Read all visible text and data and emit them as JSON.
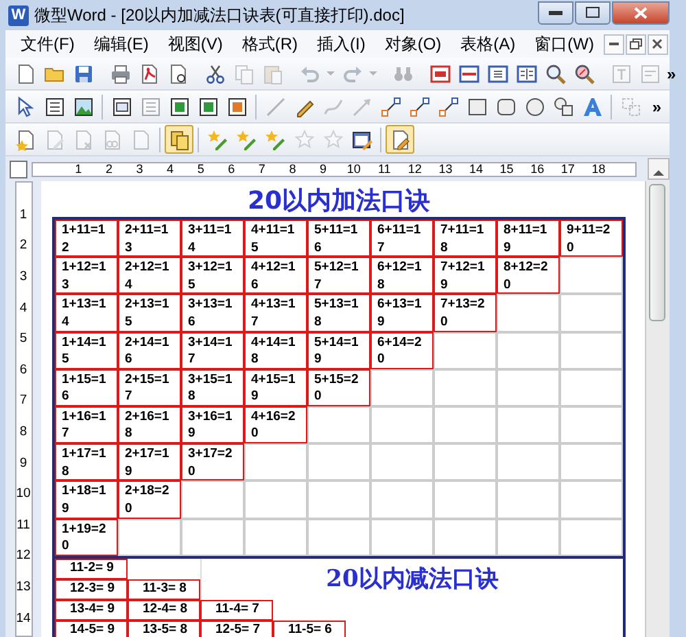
{
  "window": {
    "icon_letter": "W",
    "title": "微型Word - [20以内加减法口诀表(可直接打印).doc]"
  },
  "menu": [
    {
      "label": "文件(F)"
    },
    {
      "label": "编辑(E)"
    },
    {
      "label": "视图(V)"
    },
    {
      "label": "格式(R)"
    },
    {
      "label": "插入(I)"
    },
    {
      "label": "对象(O)"
    },
    {
      "label": "表格(A)"
    },
    {
      "label": "窗口(W)"
    }
  ],
  "toolbars": [
    {
      "overflow": "»",
      "groups": [
        [
          {
            "kind": "page",
            "disabled": false,
            "pressed": false
          },
          {
            "kind": "folder",
            "disabled": false,
            "pressed": false
          },
          {
            "kind": "disk",
            "disabled": false,
            "pressed": false
          }
        ],
        [
          {
            "kind": "printer",
            "disabled": false,
            "pressed": false
          },
          {
            "kind": "pdf",
            "disabled": false,
            "pressed": false
          },
          {
            "kind": "preview",
            "disabled": false,
            "pressed": false
          }
        ],
        [
          {
            "kind": "scissors",
            "disabled": false,
            "pressed": false
          },
          {
            "kind": "copy",
            "disabled": true,
            "pressed": false
          },
          {
            "kind": "paste",
            "disabled": true,
            "pressed": false
          }
        ],
        [
          {
            "kind": "undo",
            "disabled": true,
            "pressed": false
          },
          {
            "kind": "dropdown",
            "disabled": true,
            "pressed": false
          },
          {
            "kind": "redo",
            "disabled": true,
            "pressed": false
          },
          {
            "kind": "dropdown",
            "disabled": true,
            "pressed": false
          }
        ],
        [
          {
            "kind": "binoculars",
            "disabled": true,
            "pressed": false
          }
        ],
        [
          {
            "kind": "actual-size",
            "disabled": false,
            "pressed": false
          },
          {
            "kind": "fit-width",
            "disabled": false,
            "pressed": false
          },
          {
            "kind": "page-view",
            "disabled": false,
            "pressed": false
          },
          {
            "kind": "two-page",
            "disabled": false,
            "pressed": false
          },
          {
            "kind": "magnifier",
            "disabled": false,
            "pressed": false
          },
          {
            "kind": "zoom-percent",
            "disabled": false,
            "pressed": false
          }
        ],
        [
          {
            "kind": "text-box",
            "disabled": true,
            "pressed": false
          },
          {
            "kind": "field",
            "disabled": true,
            "pressed": false
          }
        ]
      ]
    },
    {
      "overflow": "»",
      "groups": [
        [
          {
            "kind": "cursor",
            "disabled": false,
            "pressed": false
          },
          {
            "kind": "frame",
            "disabled": false,
            "pressed": false
          },
          {
            "kind": "picture",
            "disabled": false,
            "pressed": false
          }
        ],
        [
          {
            "kind": "ole",
            "disabled": false,
            "pressed": false
          },
          {
            "kind": "frame",
            "disabled": true,
            "pressed": false
          },
          {
            "kind": "frame-green",
            "disabled": false,
            "pressed": false
          },
          {
            "kind": "frame-green",
            "disabled": false,
            "pressed": false
          },
          {
            "kind": "frame-orange",
            "disabled": false,
            "pressed": false
          }
        ],
        [
          {
            "kind": "line",
            "disabled": true,
            "pressed": false
          },
          {
            "kind": "pencil",
            "disabled": false,
            "pressed": false
          },
          {
            "kind": "curve",
            "disabled": true,
            "pressed": false
          },
          {
            "kind": "arrow-line",
            "disabled": true,
            "pressed": false
          },
          {
            "kind": "connector",
            "disabled": false,
            "pressed": false
          },
          {
            "kind": "connector",
            "disabled": false,
            "pressed": false
          },
          {
            "kind": "connector",
            "disabled": false,
            "pressed": false
          },
          {
            "kind": "rect",
            "disabled": false,
            "pressed": false
          },
          {
            "kind": "rounded-rect",
            "disabled": false,
            "pressed": false
          },
          {
            "kind": "ellipse",
            "disabled": false,
            "pressed": false
          },
          {
            "kind": "callout",
            "disabled": false,
            "pressed": false
          },
          {
            "kind": "letter-a",
            "disabled": false,
            "pressed": false
          }
        ],
        [
          {
            "kind": "group",
            "disabled": true,
            "pressed": false
          }
        ]
      ]
    },
    {
      "groups": [
        [
          {
            "kind": "doc-star",
            "disabled": false,
            "pressed": false
          },
          {
            "kind": "doc-edit",
            "disabled": true,
            "pressed": false
          },
          {
            "kind": "doc-x",
            "disabled": true,
            "pressed": false
          },
          {
            "kind": "doc-link",
            "disabled": true,
            "pressed": false
          },
          {
            "kind": "page",
            "disabled": true,
            "pressed": false
          }
        ],
        [
          {
            "kind": "doc-copy",
            "disabled": false,
            "pressed": true
          }
        ],
        [
          {
            "kind": "star-pencil",
            "disabled": false,
            "pressed": false
          },
          {
            "kind": "star-pencil",
            "disabled": false,
            "pressed": false
          },
          {
            "kind": "star-pencil",
            "disabled": false,
            "pressed": false
          },
          {
            "kind": "star-outline",
            "disabled": true,
            "pressed": false
          },
          {
            "kind": "star-outline",
            "disabled": true,
            "pressed": false
          },
          {
            "kind": "form-edit",
            "disabled": false,
            "pressed": false
          }
        ],
        [
          {
            "kind": "doc-pencil",
            "disabled": false,
            "pressed": true
          }
        ]
      ]
    }
  ],
  "ruler": {
    "numbers": [
      "1",
      "2",
      "3",
      "4",
      "5",
      "6",
      "7",
      "8",
      "9",
      "10",
      "11",
      "12",
      "13",
      "14",
      "15",
      "16",
      "17",
      "18"
    ]
  },
  "vertical_ruler": {
    "numbers": [
      "1",
      "2",
      "3",
      "4",
      "5",
      "6",
      "7",
      "8",
      "9",
      "10",
      "11",
      "12",
      "13",
      "14"
    ]
  },
  "addition_table": {
    "title": "20以内加法口诀",
    "rows": [
      [
        "1+11=12",
        "2+11=13",
        "3+11=14",
        "4+11=15",
        "5+11=16",
        "6+11=17",
        "7+11=18",
        "8+11=19",
        "9+11=20"
      ],
      [
        "1+12=13",
        "2+12=14",
        "3+12=15",
        "4+12=16",
        "5+12=17",
        "6+12=18",
        "7+12=19",
        "8+12=20"
      ],
      [
        "1+13=14",
        "2+13=15",
        "3+13=16",
        "4+13=17",
        "5+13=18",
        "6+13=19",
        "7+13=20"
      ],
      [
        "1+14=15",
        "2+14=16",
        "3+14=17",
        "4+14=18",
        "5+14=19",
        "6+14=20"
      ],
      [
        "1+15=16",
        "2+15=17",
        "3+15=18",
        "4+15=19",
        "5+15=20"
      ],
      [
        "1+16=17",
        "2+16=18",
        "3+16=19",
        "4+16=20"
      ],
      [
        "1+17=18",
        "2+17=19",
        "3+17=20"
      ],
      [
        "1+18=19",
        "2+18=20"
      ],
      [
        "1+19=20"
      ]
    ]
  },
  "subtraction_table": {
    "title": "20以内减法口诀",
    "rows": [
      [
        "11-2= 9"
      ],
      [
        "12-3= 9",
        "11-3= 8"
      ],
      [
        "13-4= 9",
        "12-4= 8",
        "11-4= 7"
      ],
      [
        "14-5= 9",
        "13-5= 8",
        "12-5= 7",
        "11-5= 6"
      ]
    ]
  }
}
